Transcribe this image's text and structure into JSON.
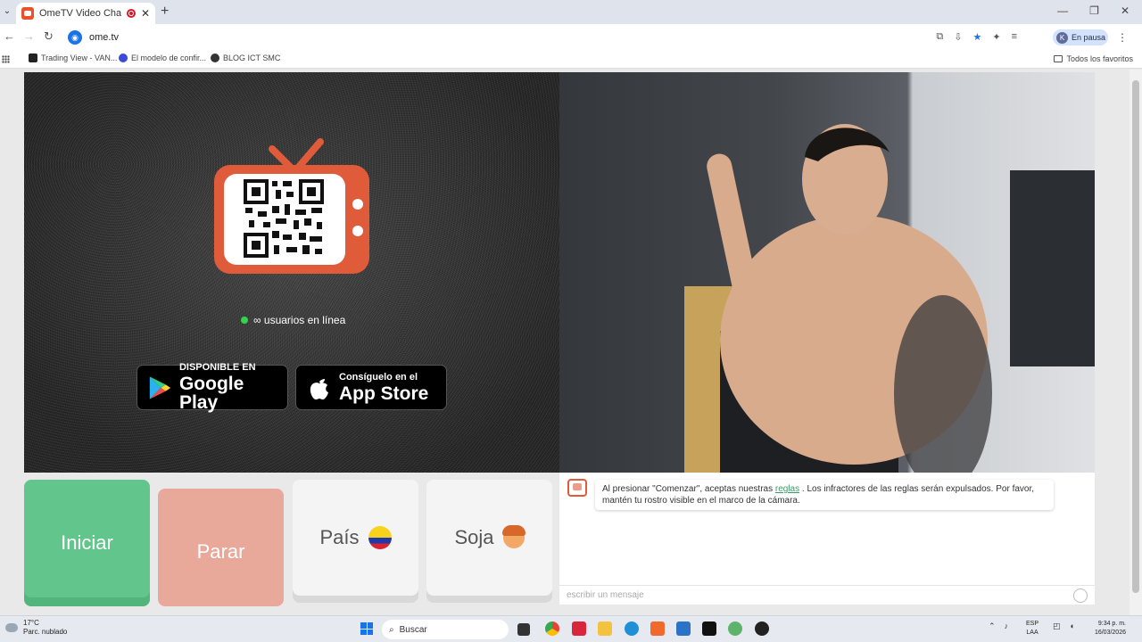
{
  "browser": {
    "tab_title": "OmeTV Video Chat — Alte",
    "url": "ome.tv",
    "profile_label": "En pausa",
    "profile_initial": "K",
    "bookmarks": [
      "Trading View - VAN...",
      "El modelo de confir...",
      "BLOG ICT SMC"
    ],
    "favorites_label": "Todos los favoritos"
  },
  "left_panel": {
    "online_text": "∞ usuarios en línea",
    "google_play_small": "DISPONIBLE EN",
    "google_play_big": "Google Play",
    "app_store_small": "Consíguelo en el",
    "app_store_big": "App Store"
  },
  "controls": {
    "start_label": "Iniciar",
    "stop_label": "Parar",
    "country_label": "País",
    "gender_label": "Soja"
  },
  "chat": {
    "message_before_link": "Al presionar \"Comenzar\", aceptas nuestras ",
    "link_text": "reglas",
    "message_after_link": " . Los infractores de las reglas serán expulsados. Por favor, mantén tu rostro visible en el marco de la cámara.",
    "input_placeholder": "escribir un mensaje"
  },
  "taskbar": {
    "weather_temp": "17°C",
    "weather_desc": "Parc. nublado",
    "search_label": "Buscar",
    "lang_top": "ESP",
    "lang_bottom": "LAA",
    "time": "9:34 p. m.",
    "date": "16/03/2026"
  },
  "colors": {
    "start_button": "#62c58b",
    "stop_button": "#e8a99a",
    "brand_orange": "#e05b3a",
    "online_green": "#33d44a"
  }
}
